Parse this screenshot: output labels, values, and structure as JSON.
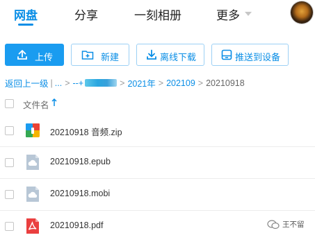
{
  "nav": {
    "tabs": [
      {
        "label": "网盘",
        "active": true
      },
      {
        "label": "分享",
        "active": false
      },
      {
        "label": "一刻相册",
        "active": false
      },
      {
        "label": "更多",
        "active": false
      }
    ]
  },
  "toolbar": {
    "upload_label": "上传",
    "new_label": "新建",
    "offline_download_label": "离线下载",
    "push_device_label": "推送到设备"
  },
  "breadcrumb": {
    "back": "返回上一级",
    "ellipsis": "...",
    "partial": "--+",
    "items": [
      "2021年",
      "202109"
    ],
    "current": "20210918",
    "separator": ">"
  },
  "list": {
    "header_label": "文件名",
    "sort": "ascending",
    "files": [
      {
        "name": "20210918 音频.zip",
        "icon": "zip-archive-icon"
      },
      {
        "name": "20210918.epub",
        "icon": "cloud-file-icon"
      },
      {
        "name": "20210918.mobi",
        "icon": "cloud-file-icon"
      },
      {
        "name": "20210918.pdf",
        "icon": "pdf-file-icon"
      }
    ]
  },
  "watermark": {
    "text": "王不留"
  },
  "colors": {
    "accent": "#0a8ee6",
    "primary_button": "#1a9cf0",
    "pdf": "#ea3f3f",
    "cloud_file": "#b8c7d6"
  }
}
